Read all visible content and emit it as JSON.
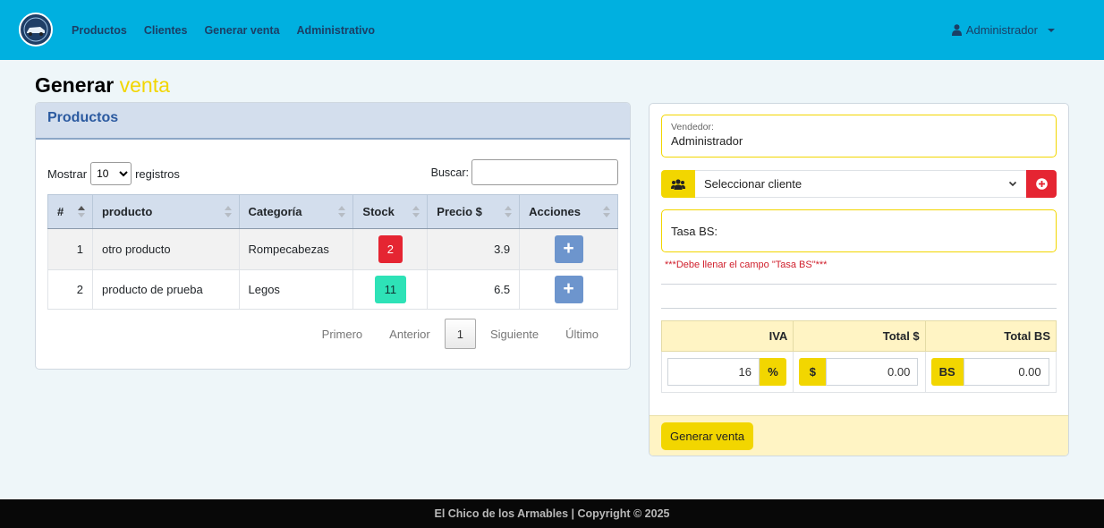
{
  "nav": {
    "links": [
      "Productos",
      "Clientes",
      "Generar venta",
      "Administrativo"
    ],
    "user": "Administrador"
  },
  "page": {
    "title": "Generar",
    "title_accent": "venta"
  },
  "products": {
    "header": "Productos",
    "show_label": "Mostrar",
    "page_size": "10",
    "records_label": "registros",
    "search_label": "Buscar:",
    "search_value": "",
    "columns": [
      "#",
      "producto",
      "Categoría",
      "Stock",
      "Precio $",
      "Acciones"
    ],
    "rows": [
      {
        "num": "1",
        "name": "otro producto",
        "category": "Rompecabezas",
        "stock": "2",
        "price": "3.9",
        "action": "+"
      },
      {
        "num": "2",
        "name": "producto de prueba",
        "category": "Legos",
        "stock": "11",
        "price": "6.5",
        "action": "+"
      }
    ],
    "pagination": {
      "first": "Primero",
      "prev": "Anterior",
      "current": "1",
      "next": "Siguiente",
      "last": "Último"
    }
  },
  "sale": {
    "seller_label": "Vendedor:",
    "seller_value": "Administrador",
    "client_placeholder": "Seleccionar cliente",
    "rate_label": "Tasa BS:",
    "rate_error": "***Debe llenar el campo \"Tasa BS\"***",
    "totals_headers": [
      "IVA",
      "Total $",
      "Total BS"
    ],
    "iva_value": "16",
    "iva_suffix": "%",
    "usd_prefix": "$",
    "usd_value": "0.00",
    "bs_prefix": "BS",
    "bs_value": "0.00",
    "generate_button": "Generar venta"
  },
  "footer": {
    "text": "El Chico de los Armables | Copyright © 2025"
  },
  "colors": {
    "navbar": "#00b0e0",
    "accent": "#f2d600",
    "danger": "#e52532",
    "success": "#2ee2b7",
    "primary": "#6d95cd"
  }
}
